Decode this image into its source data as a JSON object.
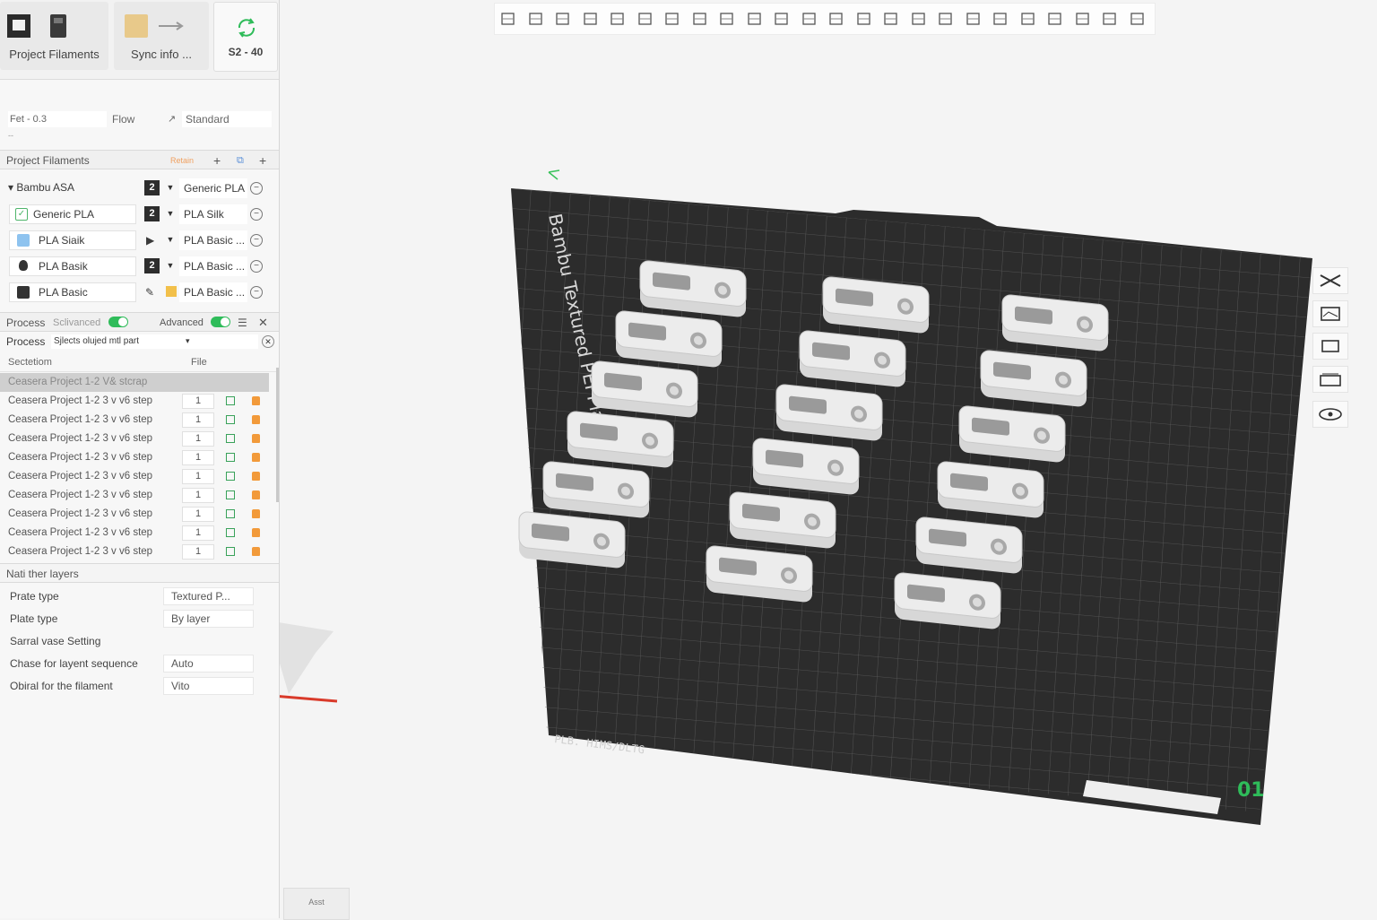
{
  "top_cards": [
    {
      "label": "Project Filaments"
    },
    {
      "label": "Sync info ..."
    },
    {
      "label": "S2 - 40"
    }
  ],
  "settings_row": {
    "field1": "Fet - 0.3",
    "field2": "Flow",
    "field3": "Standard",
    "field4": "--"
  },
  "filaments": {
    "header": "Project Filaments",
    "header_badge": "Retain",
    "items": [
      {
        "name": "Bambu ASA",
        "num": "2",
        "type": "Generic PLA"
      },
      {
        "name": "Generic PLA",
        "num": "2",
        "type": "PLA Silk"
      },
      {
        "name": "PLA Siaik",
        "num": "",
        "type": "PLA Basic ..."
      },
      {
        "name": "PLA Basik",
        "num": "2",
        "type": "PLA Basic ..."
      },
      {
        "name": "PLA Basic",
        "num": "",
        "type": "PLA Basic ..."
      }
    ]
  },
  "process": {
    "label": "Process",
    "mode1": "Sclivanced",
    "mode2": "Advanced",
    "label2": "Process",
    "select_text": "Sjlects  olujed  mtl part"
  },
  "objects": {
    "col1": "Sectetiom",
    "col2": "File",
    "selected": "Ceasera Project 1-2 V& stcrap",
    "rows": [
      {
        "name": "Ceasera Project 1-2 3 v v6 step",
        "count": "1"
      },
      {
        "name": "Ceasera Project 1-2 3 v v6 step",
        "count": "1"
      },
      {
        "name": "Ceasera Project 1-2 3 v v6 step",
        "count": "1"
      },
      {
        "name": "Ceasera Project 1-2 3 v v6 step",
        "count": "1"
      },
      {
        "name": "Ceasera Project 1-2 3 v v6 step",
        "count": "1"
      },
      {
        "name": "Ceasera Project 1-2 3 v v6 step",
        "count": "1"
      },
      {
        "name": "Ceasera Project 1-2 3 v v6 step",
        "count": "1"
      },
      {
        "name": "Ceasera Project 1-2 3 v v6 step",
        "count": "1"
      },
      {
        "name": "Ceasera Project 1-2 3 v v6 step",
        "count": "1"
      }
    ]
  },
  "plate_settings": {
    "header": "Nati ther layers",
    "props": [
      {
        "k": "Prate type",
        "v": "Textured P..."
      },
      {
        "k": "Plate type",
        "v": "By layer"
      },
      {
        "k": "Sarral vase Setting",
        "v": ""
      },
      {
        "k": "Chase for layent sequence",
        "v": "Auto"
      },
      {
        "k": "Obiral for the filament",
        "v": "Vito"
      }
    ]
  },
  "plate": {
    "brand_text": "Bambu Textured PEI Plate",
    "bottom_text": "PLB. HIMS/DLTG",
    "plate_number": "01"
  },
  "assistant": {
    "label": "Asst"
  },
  "colors": {
    "accent": "#2fbc5a",
    "plate": "#2c2c2c",
    "parts": "#e6e6e6"
  }
}
